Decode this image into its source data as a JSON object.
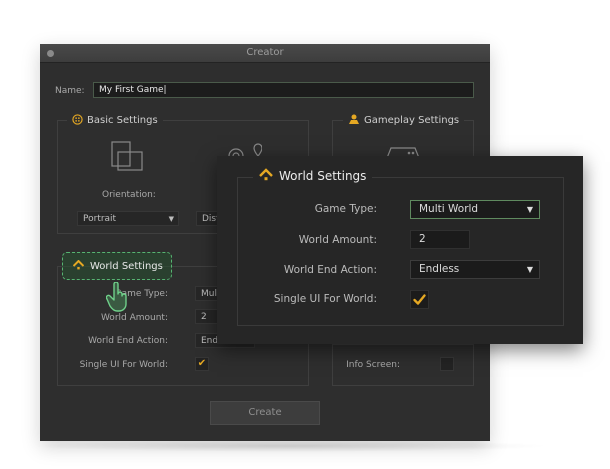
{
  "window": {
    "title": "Creator"
  },
  "name_field": {
    "label": "Name:",
    "value": "My First Game"
  },
  "basic_settings": {
    "title": "Basic Settings",
    "orientation_label": "Orientation:",
    "orientation_value": "Portrait",
    "second_dropdown_partial": "Dist"
  },
  "gameplay_settings": {
    "title": "Gameplay Settings",
    "info_screen_label": "Info Screen:"
  },
  "world_settings_bg": {
    "title": "World Settings",
    "game_type_label": "Game Type:",
    "game_type_partial": "Mult",
    "world_amount_label": "World Amount:",
    "world_amount_value": "2",
    "world_end_label": "World End Action:",
    "world_end_partial": "End",
    "single_ui_label": "Single UI For World:"
  },
  "create_button": {
    "label": "Create"
  },
  "popup": {
    "title": "World Settings",
    "game_type": {
      "label": "Game Type:",
      "value": "Multi World"
    },
    "world_amount": {
      "label": "World Amount:",
      "value": "2"
    },
    "world_end_action": {
      "label": "World End Action:",
      "value": "Endless"
    },
    "single_ui": {
      "label": "Single UI For World:",
      "checked": true
    }
  },
  "colors": {
    "accent": "#e5a823",
    "window_bg": "#2e2e2e",
    "panel_bg": "#262626",
    "highlight": "#57b472"
  }
}
